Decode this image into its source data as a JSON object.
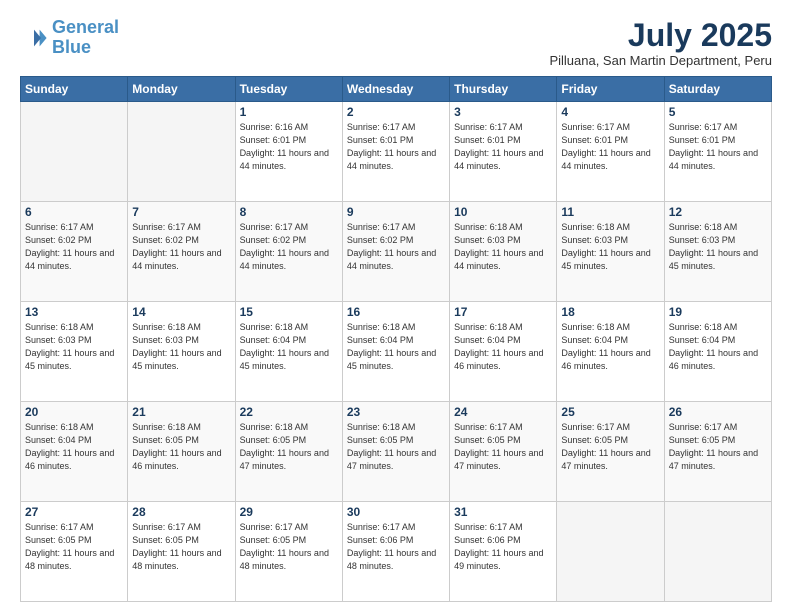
{
  "header": {
    "logo_line1": "General",
    "logo_line2": "Blue",
    "month": "July 2025",
    "location": "Pilluana, San Martin Department, Peru"
  },
  "weekdays": [
    "Sunday",
    "Monday",
    "Tuesday",
    "Wednesday",
    "Thursday",
    "Friday",
    "Saturday"
  ],
  "weeks": [
    [
      {
        "day": "",
        "empty": true
      },
      {
        "day": "",
        "empty": true
      },
      {
        "day": "1",
        "rise": "6:16 AM",
        "set": "6:01 PM",
        "daylight": "11 hours and 44 minutes."
      },
      {
        "day": "2",
        "rise": "6:17 AM",
        "set": "6:01 PM",
        "daylight": "11 hours and 44 minutes."
      },
      {
        "day": "3",
        "rise": "6:17 AM",
        "set": "6:01 PM",
        "daylight": "11 hours and 44 minutes."
      },
      {
        "day": "4",
        "rise": "6:17 AM",
        "set": "6:01 PM",
        "daylight": "11 hours and 44 minutes."
      },
      {
        "day": "5",
        "rise": "6:17 AM",
        "set": "6:01 PM",
        "daylight": "11 hours and 44 minutes."
      }
    ],
    [
      {
        "day": "6",
        "rise": "6:17 AM",
        "set": "6:02 PM",
        "daylight": "11 hours and 44 minutes."
      },
      {
        "day": "7",
        "rise": "6:17 AM",
        "set": "6:02 PM",
        "daylight": "11 hours and 44 minutes."
      },
      {
        "day": "8",
        "rise": "6:17 AM",
        "set": "6:02 PM",
        "daylight": "11 hours and 44 minutes."
      },
      {
        "day": "9",
        "rise": "6:17 AM",
        "set": "6:02 PM",
        "daylight": "11 hours and 44 minutes."
      },
      {
        "day": "10",
        "rise": "6:18 AM",
        "set": "6:03 PM",
        "daylight": "11 hours and 44 minutes."
      },
      {
        "day": "11",
        "rise": "6:18 AM",
        "set": "6:03 PM",
        "daylight": "11 hours and 45 minutes."
      },
      {
        "day": "12",
        "rise": "6:18 AM",
        "set": "6:03 PM",
        "daylight": "11 hours and 45 minutes."
      }
    ],
    [
      {
        "day": "13",
        "rise": "6:18 AM",
        "set": "6:03 PM",
        "daylight": "11 hours and 45 minutes."
      },
      {
        "day": "14",
        "rise": "6:18 AM",
        "set": "6:03 PM",
        "daylight": "11 hours and 45 minutes."
      },
      {
        "day": "15",
        "rise": "6:18 AM",
        "set": "6:04 PM",
        "daylight": "11 hours and 45 minutes."
      },
      {
        "day": "16",
        "rise": "6:18 AM",
        "set": "6:04 PM",
        "daylight": "11 hours and 45 minutes."
      },
      {
        "day": "17",
        "rise": "6:18 AM",
        "set": "6:04 PM",
        "daylight": "11 hours and 46 minutes."
      },
      {
        "day": "18",
        "rise": "6:18 AM",
        "set": "6:04 PM",
        "daylight": "11 hours and 46 minutes."
      },
      {
        "day": "19",
        "rise": "6:18 AM",
        "set": "6:04 PM",
        "daylight": "11 hours and 46 minutes."
      }
    ],
    [
      {
        "day": "20",
        "rise": "6:18 AM",
        "set": "6:04 PM",
        "daylight": "11 hours and 46 minutes."
      },
      {
        "day": "21",
        "rise": "6:18 AM",
        "set": "6:05 PM",
        "daylight": "11 hours and 46 minutes."
      },
      {
        "day": "22",
        "rise": "6:18 AM",
        "set": "6:05 PM",
        "daylight": "11 hours and 47 minutes."
      },
      {
        "day": "23",
        "rise": "6:18 AM",
        "set": "6:05 PM",
        "daylight": "11 hours and 47 minutes."
      },
      {
        "day": "24",
        "rise": "6:17 AM",
        "set": "6:05 PM",
        "daylight": "11 hours and 47 minutes."
      },
      {
        "day": "25",
        "rise": "6:17 AM",
        "set": "6:05 PM",
        "daylight": "11 hours and 47 minutes."
      },
      {
        "day": "26",
        "rise": "6:17 AM",
        "set": "6:05 PM",
        "daylight": "11 hours and 47 minutes."
      }
    ],
    [
      {
        "day": "27",
        "rise": "6:17 AM",
        "set": "6:05 PM",
        "daylight": "11 hours and 48 minutes."
      },
      {
        "day": "28",
        "rise": "6:17 AM",
        "set": "6:05 PM",
        "daylight": "11 hours and 48 minutes."
      },
      {
        "day": "29",
        "rise": "6:17 AM",
        "set": "6:05 PM",
        "daylight": "11 hours and 48 minutes."
      },
      {
        "day": "30",
        "rise": "6:17 AM",
        "set": "6:06 PM",
        "daylight": "11 hours and 48 minutes."
      },
      {
        "day": "31",
        "rise": "6:17 AM",
        "set": "6:06 PM",
        "daylight": "11 hours and 49 minutes."
      },
      {
        "day": "",
        "empty": true
      },
      {
        "day": "",
        "empty": true
      }
    ]
  ]
}
